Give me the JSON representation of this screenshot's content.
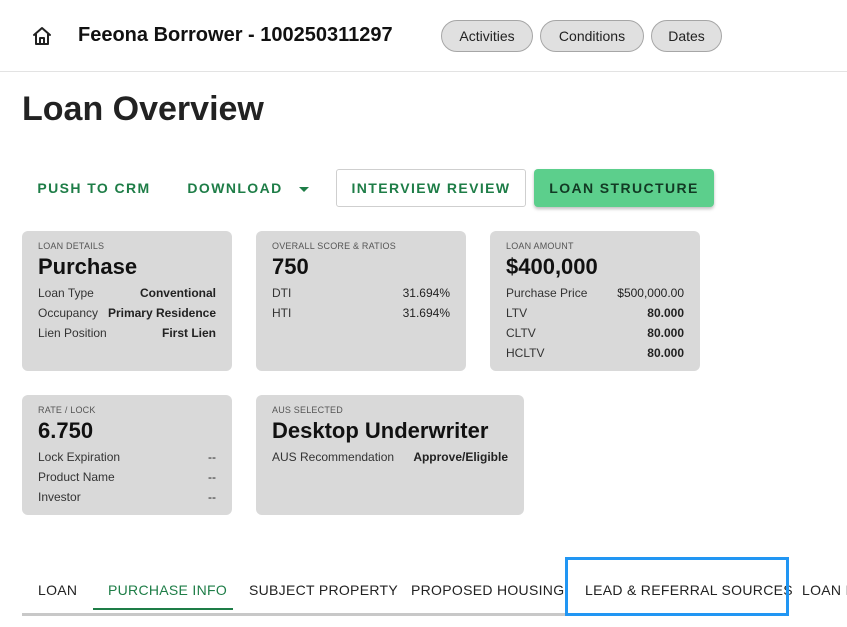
{
  "header": {
    "borrower_title": "Feeona Borrower - 100250311297",
    "chips": [
      "Activities",
      "Conditions",
      "Dates"
    ]
  },
  "page_title": "Loan Overview",
  "actions": {
    "push_to_crm": "PUSH TO CRM",
    "download": "DOWNLOAD",
    "interview_review": "INTERVIEW REVIEW",
    "loan_structure": "LOAN STRUCTURE"
  },
  "cards": {
    "loan_details": {
      "label": "LOAN DETAILS",
      "value": "Purchase",
      "rows": [
        {
          "k": "Loan Type",
          "v": "Conventional"
        },
        {
          "k": "Occupancy",
          "v": "Primary Residence"
        },
        {
          "k": "Lien Position",
          "v": "First Lien"
        }
      ]
    },
    "score": {
      "label": "OVERALL SCORE & RATIOS",
      "value": "750",
      "rows": [
        {
          "k": "DTI",
          "v": "31.694%"
        },
        {
          "k": "HTI",
          "v": "31.694%"
        }
      ]
    },
    "amount": {
      "label": "LOAN AMOUNT",
      "value": "$400,000",
      "rows": [
        {
          "k": "Purchase Price",
          "v": "$500,000.00"
        },
        {
          "k": "LTV",
          "v": "80.000"
        },
        {
          "k": "CLTV",
          "v": "80.000"
        },
        {
          "k": "HCLTV",
          "v": "80.000"
        }
      ]
    },
    "rate": {
      "label": "RATE / LOCK",
      "value": "6.750",
      "rows": [
        {
          "k": "Lock Expiration",
          "v": "--"
        },
        {
          "k": "Product Name",
          "v": "--"
        },
        {
          "k": "Investor",
          "v": "--"
        }
      ]
    },
    "aus": {
      "label": "AUS SELECTED",
      "value": "Desktop Underwriter",
      "rows": [
        {
          "k": "AUS Recommendation",
          "v": "Approve/Eligible"
        }
      ]
    }
  },
  "tabs": [
    "LOAN",
    "PURCHASE INFO",
    "SUBJECT PROPERTY",
    "PROPOSED HOUSING",
    "LEAD & REFERRAL SOURCES",
    "LOAN I"
  ],
  "active_tab": "PURCHASE INFO",
  "colors": {
    "accent_green": "#1e7d47",
    "button_green": "#5ccf8c",
    "card_bg": "#d9d9d9",
    "highlight_blue": "#2196f3"
  }
}
